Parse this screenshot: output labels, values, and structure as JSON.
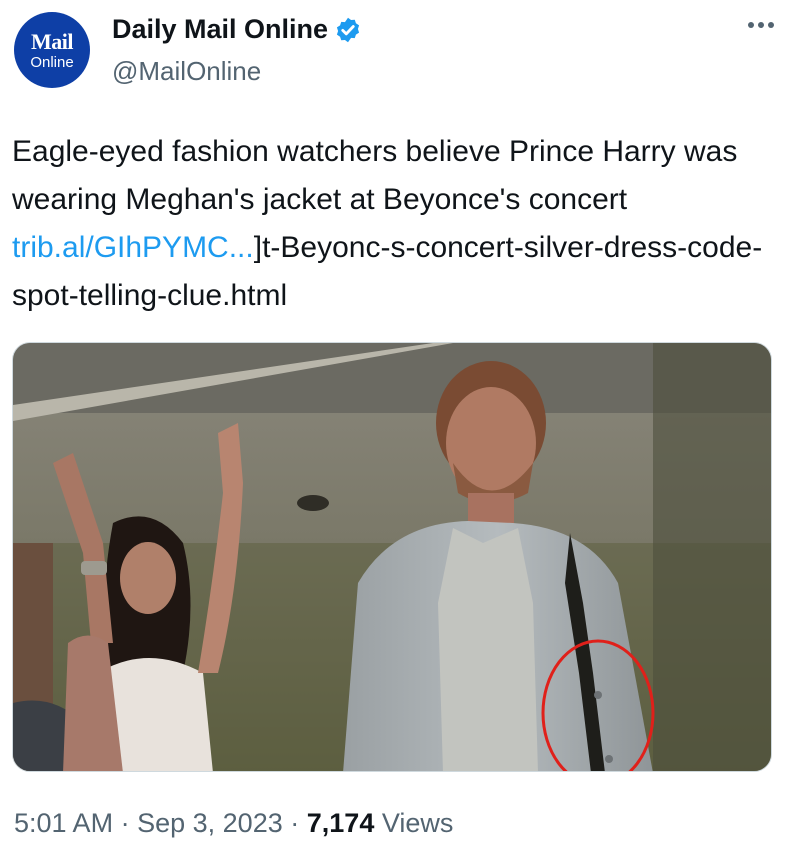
{
  "account": {
    "avatar_logo_top": "Mail",
    "avatar_logo_bottom": "Online",
    "display_name": "Daily Mail Online",
    "handle": "@MailOnline",
    "verified": true
  },
  "tweet": {
    "text_part1": "Eagle-eyed fashion watchers believe Prince Harry was wearing Meghan's jacket at Beyonce's concert ",
    "link_text": "trib.al/GIhPYMC...",
    "text_part2": "]t-Beyonc-s-concert-silver-dress-code-spot-telling-clue.html"
  },
  "meta": {
    "time": "5:01 AM",
    "separator": "·",
    "date": "Sep 3, 2023",
    "views_count": "7,174",
    "views_label": "Views"
  },
  "icons": {
    "verified": "verified-badge-icon",
    "more": "more-options-icon"
  },
  "colors": {
    "link": "#1d9bf0",
    "verified": "#1d9bf0",
    "secondary_text": "#536471",
    "annotation_circle": "#e0201a"
  }
}
